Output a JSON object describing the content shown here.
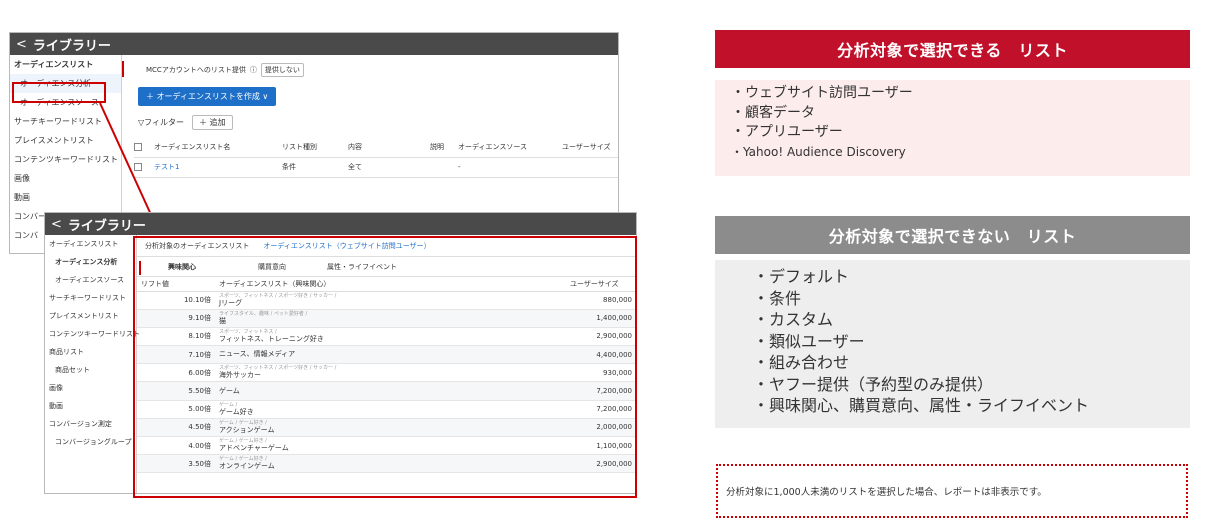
{
  "colors": {
    "accent_red": "#c00000",
    "header_red": "#c1102a",
    "header_gray": "#8c8c8c",
    "link_blue": "#1e6fc8"
  },
  "screen1": {
    "header_title": "ライブラリー",
    "back_icon": "chevron-left-icon",
    "sidebar": [
      "オーディエンスリスト",
      "オーディエンス分析",
      "オーディエンスソース",
      "サーチキーワードリスト",
      "プレイスメントリスト",
      "コンテンツキーワードリスト",
      "画像",
      "動画",
      "コンバー",
      "コンバ"
    ],
    "mcc_label": "MCCアカウントへのリスト提供",
    "mcc_value": "提供しない",
    "create_button": "＋ オーディエンスリストを作成 ∨",
    "filter_label": "▽フィルター",
    "add_button": "＋ 追加",
    "table_headers": [
      "オーディエンスリスト名",
      "リスト種別",
      "内容",
      "説明",
      "オーディエンスソース",
      "ユーザーサイズ"
    ],
    "table_row": [
      "テスト1",
      "条件",
      "全て",
      "",
      "-",
      ""
    ]
  },
  "screen2": {
    "header_title": "ライブラリー",
    "sidebar": [
      "オーディエンスリスト",
      "オーディエンス分析",
      "オーディエンスソース",
      "サーチキーワードリスト",
      "プレイスメントリスト",
      "コンテンツキーワードリスト",
      "商品リスト",
      "商品セット",
      "画像",
      "動画",
      "コンバージョン測定",
      "コンバージョングループ"
    ],
    "tabs": [
      "分析対象のオーディエンスリスト",
      "オーディエンスリスト（ウェブサイト訪問ユーザー）"
    ],
    "subtabs": [
      "興味関心",
      "購買意向",
      "属性・ライフイベント"
    ],
    "table_headers": [
      "リフト値",
      "オーディエンスリスト（興味関心）",
      "ユーザーサイズ"
    ],
    "rows": [
      {
        "lift": "10.10倍",
        "category": "スポーツ、フィットネス / スポーツ好き / サッカー /",
        "name": "Jリーグ",
        "size": "880,000"
      },
      {
        "lift": "9.10倍",
        "category": "ライフスタイル、趣味 / ペット愛好者 /",
        "name": "猫",
        "size": "1,400,000"
      },
      {
        "lift": "8.10倍",
        "category": "スポーツ、フィットネス /",
        "name": "フィットネス、トレーニング好き",
        "size": "2,900,000"
      },
      {
        "lift": "7.10倍",
        "category": "",
        "name": "ニュース、情報メディア",
        "size": "4,400,000"
      },
      {
        "lift": "6.00倍",
        "category": "スポーツ、フィットネス / スポーツ好き / サッカー /",
        "name": "海外サッカー",
        "size": "930,000"
      },
      {
        "lift": "5.50倍",
        "category": "",
        "name": "ゲーム",
        "size": "7,200,000"
      },
      {
        "lift": "5.00倍",
        "category": "ゲーム /",
        "name": "ゲーム好き",
        "size": "7,200,000"
      },
      {
        "lift": "4.50倍",
        "category": "ゲーム / ゲーム好き /",
        "name": "アクションゲーム",
        "size": "2,000,000"
      },
      {
        "lift": "4.00倍",
        "category": "ゲーム / ゲーム好き /",
        "name": "アドベンチャーゲーム",
        "size": "1,100,000"
      },
      {
        "lift": "3.50倍",
        "category": "ゲーム / ゲーム好き /",
        "name": "オンラインゲーム",
        "size": "2,900,000"
      }
    ]
  },
  "panel_selectable": {
    "title": "分析対象で選択できる　リスト",
    "items": [
      "・ウェブサイト訪問ユーザー",
      "・顧客データ",
      "・アプリユーザー",
      "・Yahoo! Audience Discovery"
    ]
  },
  "panel_not_selectable": {
    "title": "分析対象で選択できない　リスト",
    "items": [
      "・デフォルト",
      "・条件",
      "・カスタム",
      "・類似ユーザー",
      "・組み合わせ",
      "・ヤフー提供（予約型のみ提供）",
      "・興味関心、購買意向、属性・ライフイベント"
    ]
  },
  "note": "分析対象に1,000人未満のリストを選択した場合、レポートは非表示です。"
}
